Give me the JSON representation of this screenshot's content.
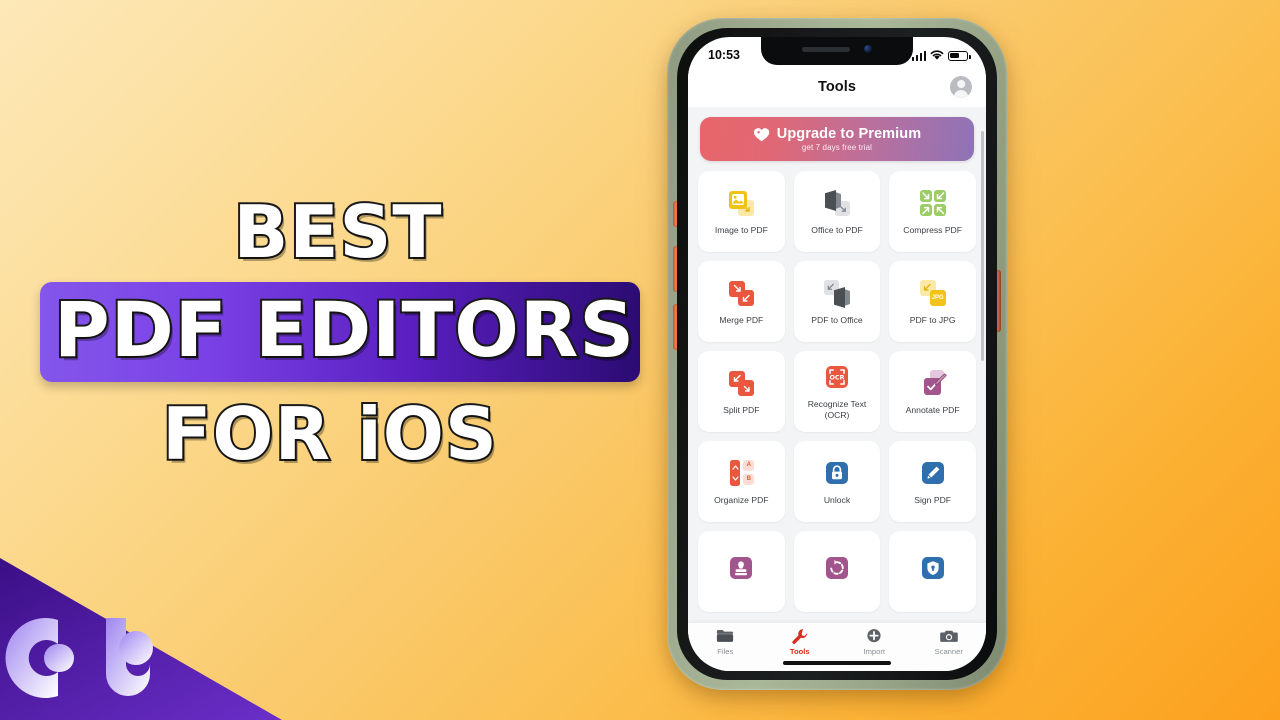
{
  "thumbnail": {
    "headline_line1": "BEST",
    "headline_line2": "PDF EDITORS",
    "headline_line3": "FOR iOS",
    "brand_logo": "gt-logo",
    "band_color": "#5a1fc0",
    "corner_color": "#4b1a9e",
    "background_start": "#fde8b8",
    "background_end": "#fca01e"
  },
  "phone": {
    "case_color": "#9aa68b",
    "button_color": "#d9603c",
    "notch_icons": [
      "speaker-icon",
      "front-camera-icon"
    ]
  },
  "app": {
    "status_bar": {
      "time": "10:53",
      "icons": [
        "cellular-signal-icon",
        "wifi-icon",
        "battery-icon"
      ],
      "battery_level": "48"
    },
    "nav": {
      "title": "Tools",
      "avatar": "account-avatar-icon"
    },
    "upgrade_banner": {
      "icon": "tag-heart-icon",
      "title": "Upgrade to Premium",
      "subtitle": "get 7 days free trial",
      "gradient_start": "#e8666a",
      "gradient_end": "#8e73b6"
    },
    "tools": [
      {
        "label": "Image to PDF",
        "icon": "image-to-pdf-icon",
        "color": "#f2c219"
      },
      {
        "label": "Office to PDF",
        "icon": "office-to-pdf-icon",
        "color": "#4a4f54"
      },
      {
        "label": "Compress PDF",
        "icon": "compress-pdf-icon",
        "color": "#7cb342"
      },
      {
        "label": "Merge PDF",
        "icon": "merge-pdf-icon",
        "color": "#e9573f"
      },
      {
        "label": "PDF to Office",
        "icon": "pdf-to-office-icon",
        "color": "#4a4f54"
      },
      {
        "label": "PDF to JPG",
        "icon": "pdf-to-jpg-icon",
        "color": "#f2c219"
      },
      {
        "label": "Split PDF",
        "icon": "split-pdf-icon",
        "color": "#e9573f"
      },
      {
        "label": "Recognize Text\n(OCR)",
        "icon": "ocr-icon",
        "color": "#e9573f"
      },
      {
        "label": "Annotate PDF",
        "icon": "annotate-pdf-icon",
        "color": "#a1558c"
      },
      {
        "label": "Organize PDF",
        "icon": "organize-pdf-icon",
        "color": "#e9573f"
      },
      {
        "label": "Unlock",
        "icon": "unlock-icon",
        "color": "#2f6fad"
      },
      {
        "label": "Sign PDF",
        "icon": "sign-pdf-icon",
        "color": "#2f6fad"
      },
      {
        "label": "",
        "icon": "stamp-icon",
        "color": "#a1558c"
      },
      {
        "label": "",
        "icon": "rotate-icon",
        "color": "#a1558c"
      },
      {
        "label": "",
        "icon": "protect-icon",
        "color": "#2f6fad"
      }
    ],
    "tabs": [
      {
        "label": "Files",
        "icon": "folder-icon",
        "active": false
      },
      {
        "label": "Tools",
        "icon": "wrench-icon",
        "active": true
      },
      {
        "label": "Import",
        "icon": "plus-icon",
        "active": false
      },
      {
        "label": "Scanner",
        "icon": "camera-icon",
        "active": false
      }
    ],
    "active_tab_color": "#d92b1f"
  }
}
